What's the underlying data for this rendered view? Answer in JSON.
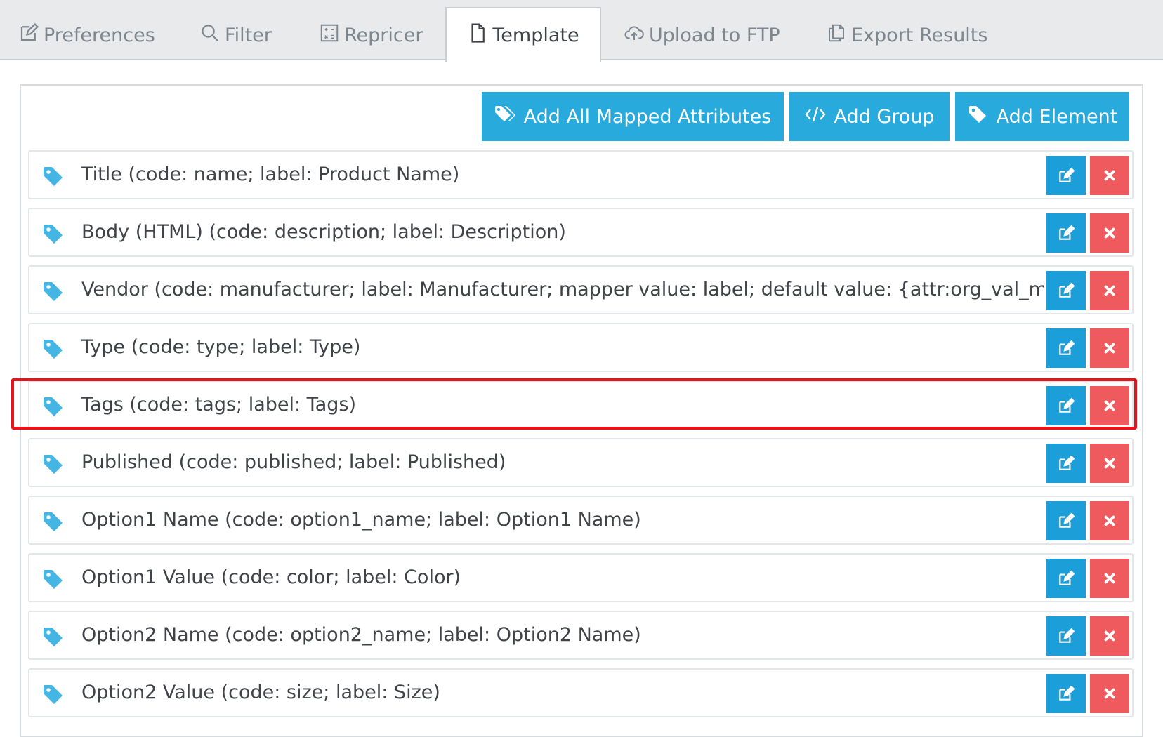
{
  "tabs": [
    {
      "label": "Preferences",
      "icon": "edit-icon"
    },
    {
      "label": "Filter",
      "icon": "search-icon"
    },
    {
      "label": "Repricer",
      "icon": "calculator-icon"
    },
    {
      "label": "Template",
      "icon": "file-icon",
      "active": true
    },
    {
      "label": "Upload to FTP",
      "icon": "cloud-upload-icon"
    },
    {
      "label": "Export Results",
      "icon": "copy-icon"
    }
  ],
  "toolbar": {
    "add_all_label": "Add All Mapped Attributes",
    "add_group_label": "Add Group",
    "add_element_label": "Add Element"
  },
  "rows": [
    {
      "label": "Title (code: name; label: Product Name)"
    },
    {
      "label": "Body (HTML) (code: description; label: Description)"
    },
    {
      "label": "Vendor (code: manufacturer; label: Manufacturer; mapper value: label; default value: {attr:org_val_ma..."
    },
    {
      "label": "Type (code: type; label: Type)"
    },
    {
      "label": "Tags (code: tags; label: Tags)",
      "highlighted": true
    },
    {
      "label": "Published (code: published; label: Published)"
    },
    {
      "label": "Option1 Name (code: option1_name; label: Option1 Name)"
    },
    {
      "label": "Option1 Value (code: color; label: Color)"
    },
    {
      "label": "Option2 Name (code: option2_name; label: Option2 Name)"
    },
    {
      "label": "Option2 Value (code: size; label: Size)"
    }
  ],
  "colors": {
    "accent": "#28aadd",
    "tag_icon": "#45b6e4",
    "edit": "#1c9fd8",
    "delete": "#ee5a5e",
    "highlight": "#e8121b"
  }
}
